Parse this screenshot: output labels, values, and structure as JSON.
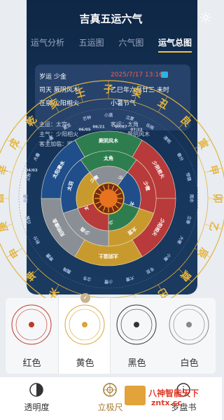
{
  "app": {
    "title": "吉真五运六气"
  },
  "tabs": [
    {
      "label": "运气分析"
    },
    {
      "label": "五运图"
    },
    {
      "label": "六气图"
    },
    {
      "label": "运气总图"
    }
  ],
  "info": {
    "year_run": "岁运 少金",
    "date": "2025/7/17 13:16",
    "sitian": "司天 厥阴风木",
    "lunar": "乙巳年六月廿三 未时",
    "zaiquan": "在泉 少阳相火",
    "solar_term": "小暑节气",
    "host_run": "主运：太宫",
    "guest_run": "客运：太角",
    "host_qi": "主气：少阳相火",
    "guest_qi": "客气：厥阴风木",
    "host_add": "客主加临：顺得，小顺"
  },
  "wheel": {
    "outer_ring": [
      "辛",
      "戌",
      "乾",
      "亥",
      "壬",
      "子",
      "癸",
      "丑",
      "艮",
      "寅",
      "甲",
      "卯",
      "乙",
      "辰",
      "巽",
      "巳",
      "丙",
      "午",
      "丁",
      "未",
      "坤",
      "申",
      "庚",
      "酉"
    ],
    "solar_terms": [
      "大暑",
      "小暑",
      "夏至",
      "芒种",
      "小满",
      "立夏",
      "谷雨",
      "清明",
      "春分",
      "惊蛰",
      "雨水",
      "立春",
      "大寒",
      "小寒",
      "冬至",
      "大雪",
      "小雪",
      "立冬",
      "霜降",
      "寒露",
      "秋分",
      "白露",
      "处暑",
      "立秋"
    ],
    "dates": [
      "06/21",
      "06/05",
      "07/07",
      "07/22",
      "04/03"
    ],
    "qi_ring": [
      "厥阴风木",
      "少阴君火",
      "少阳相火",
      "太阴湿土",
      "阳明燥金",
      "太阳寒水"
    ],
    "run_ring": [
      "太角",
      "少徵",
      "太宫",
      "少商",
      "太羽"
    ],
    "inner_ring": [
      "少羽",
      "太宫",
      "少商",
      "太角",
      "少徵"
    ]
  },
  "styles": [
    {
      "label": "红色",
      "color": "#c0392b"
    },
    {
      "label": "黄色",
      "color": "#d6a53a"
    },
    {
      "label": "黑色",
      "color": "#333333"
    },
    {
      "label": "白色",
      "color": "#888888"
    }
  ],
  "selected_style": "黄色",
  "bottom_nav": [
    {
      "label": "透明度"
    },
    {
      "label": "立极尺"
    },
    {
      "label": "罗盘书"
    }
  ],
  "watermark": {
    "title": "八神智能天下",
    "url": "zntx.cc"
  }
}
